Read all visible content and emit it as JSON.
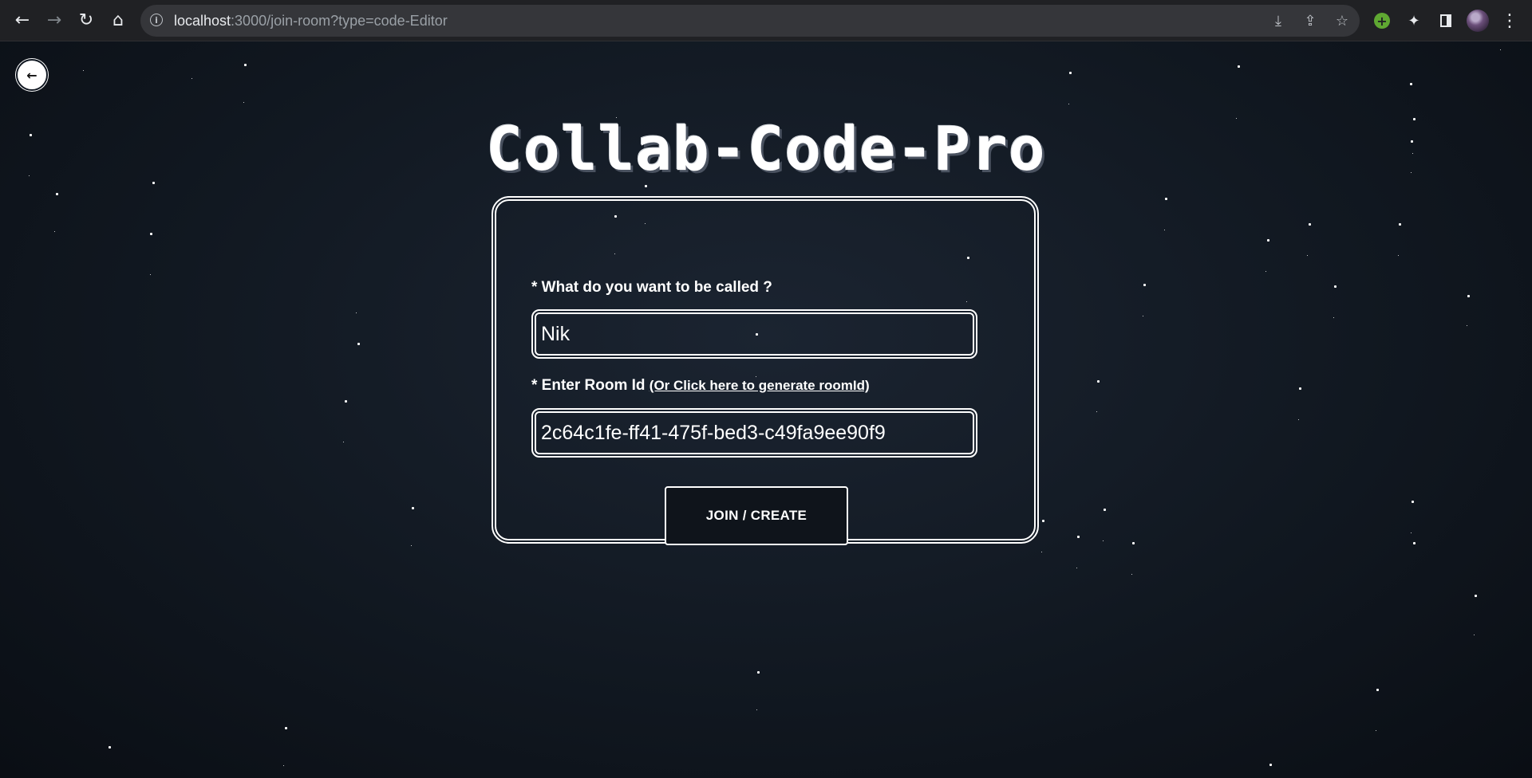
{
  "browser": {
    "url_host": "localhost",
    "url_rest": ":3000/join-room?type=code-Editor",
    "back_glyph": "←",
    "forward_glyph": "→",
    "reload_glyph": "↻",
    "home_glyph": "⌂",
    "info_glyph": "i",
    "install_glyph": "⤓",
    "share_glyph": "⇪",
    "star_glyph": "☆",
    "ext_plus_glyph": "+",
    "puzzle_glyph": "✦",
    "menu_glyph": "⋮",
    "icons": [
      "back-icon",
      "forward-icon",
      "reload-icon",
      "home-icon",
      "info-icon",
      "install-icon",
      "share-icon",
      "bookmark-star-icon",
      "extension-icon",
      "puzzle-icon",
      "side-panel-icon",
      "avatar",
      "menu-icon"
    ]
  },
  "page": {
    "back_glyph": "←",
    "title": "Collab-Code-Pro",
    "name_label": "* What do you want to be called ?",
    "name_value": "Nik",
    "room_label": "* Enter Room Id",
    "generate_link": "(Or Click here to generate roomId)",
    "room_value": "2c64c1fe-ff41-475f-bed3-c49fa9ee90f9",
    "join_button": "JOIN / CREATE"
  },
  "colors": {
    "browser_bar": "#202124",
    "omnibox": "#35363a",
    "background": "#111821",
    "foreground": "#ffffff",
    "extension_green": "#5fa832"
  }
}
